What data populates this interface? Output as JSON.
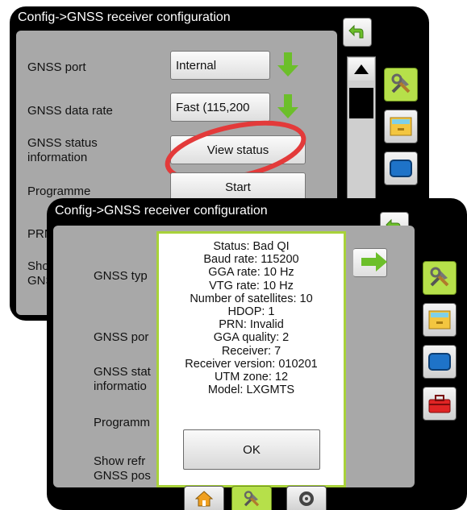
{
  "back_screen": {
    "title": "Config->GNSS receiver configuration",
    "rows": [
      {
        "label": "GNSS port",
        "value": "Internal"
      },
      {
        "label": "GNSS data rate",
        "value": "Fast (115,200"
      },
      {
        "label": "GNSS status information",
        "value": "View status"
      },
      {
        "label": "Programme",
        "value": "Start"
      },
      {
        "label": "PRN"
      },
      {
        "label": "Show GNS"
      }
    ]
  },
  "front_screen": {
    "title": "Config->GNSS receiver configuration",
    "rows": [
      {
        "label": "GNSS typ"
      },
      {
        "label": "GNSS por"
      },
      {
        "label": "GNSS stat informatio"
      },
      {
        "label": "Programm"
      },
      {
        "label": "Show refr GNSS pos"
      }
    ]
  },
  "status_dialog": {
    "lines": [
      "Status: Bad QI",
      "Baud rate: 115200",
      "GGA rate: 10 Hz",
      "VTG rate: 10 Hz",
      "Number of satellites: 10",
      "HDOP: 1",
      "PRN: Invalid",
      "GGA quality: 2",
      "Receiver: 7",
      "Receiver version: 010201",
      "UTM zone: 12",
      "Model: LXGMTS"
    ],
    "ok_label": "OK"
  },
  "side_tabs": [
    "tools-icon",
    "storage-icon",
    "display-icon",
    "toolbox-icon"
  ],
  "bottom_tabs": [
    "home-icon",
    "tools-icon",
    "gnss-icon"
  ],
  "colors": {
    "accent_green": "#a8d23a",
    "arrow_green": "#6cbf2a",
    "highlight_red": "#e33a3a",
    "screen_grey": "#a8a8a8"
  }
}
